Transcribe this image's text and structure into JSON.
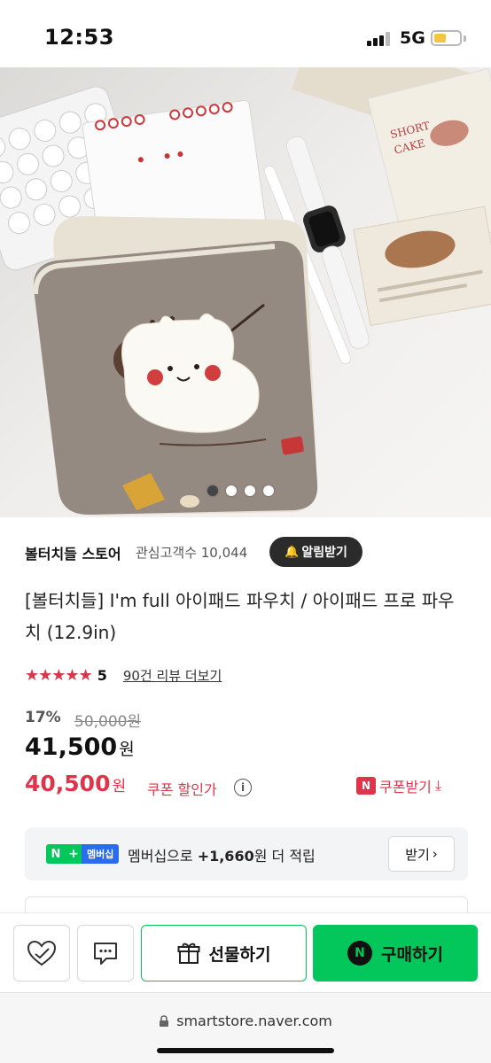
{
  "status": {
    "time": "12:53",
    "network": "5G"
  },
  "carousel": {
    "page_count": 4,
    "active_index": 0
  },
  "store": {
    "name": "볼터치들 스토어",
    "followers": "관심고객수 10,044",
    "notify_label": "알림받기"
  },
  "product": {
    "title": "[볼터치들] I'm full 아이패드 파우치 / 아이패드 프로 파우치 (12.9in)",
    "stars": "★★★★★",
    "rating": "5",
    "review_link": "90건 리뷰 더보기",
    "discount": "17%",
    "original_price": "50,000원",
    "price": "41,500",
    "price_unit": "원",
    "coupon_price": "40,500",
    "coupon_unit": "원",
    "coupon_label": "쿠폰 할인가",
    "coupon_get": "쿠폰받기"
  },
  "membership": {
    "badge_n": "N",
    "badge_plus": "+",
    "badge_label": "멤버십",
    "text_prefix": "멤버십으로 ",
    "points": "+1,660",
    "text_suffix": "원 더 적립",
    "button": "받기"
  },
  "actions": {
    "gift": "선물하기",
    "buy": "구매하기"
  },
  "url": "smartstore.naver.com",
  "colors": {
    "naver_green": "#03c75a",
    "accent_red": "#e0344a",
    "star_red": "#d6374a"
  }
}
